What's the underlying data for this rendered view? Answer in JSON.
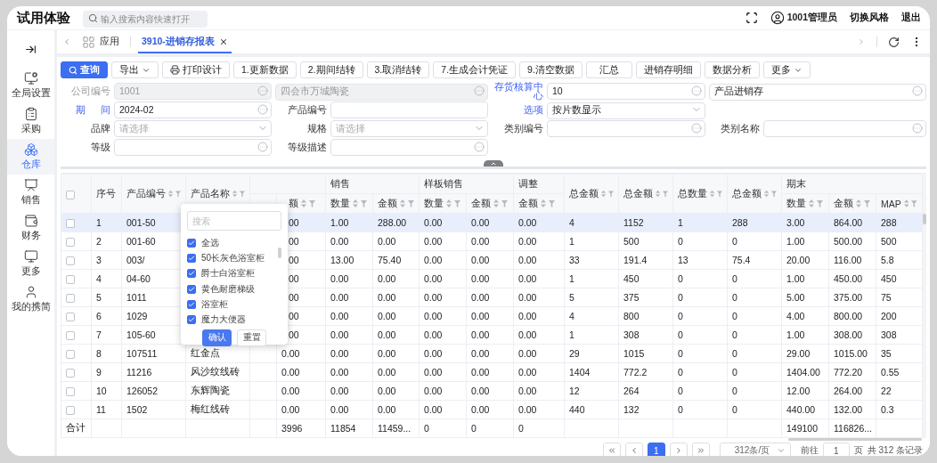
{
  "app": {
    "title": "试用体验",
    "search_placeholder": "输入搜索内容快速打开",
    "user": "1001管理员",
    "actions": [
      "切换风格",
      "退出"
    ]
  },
  "sidebar": {
    "items": [
      {
        "label": "全局设置",
        "selected": false
      },
      {
        "label": "采购",
        "selected": false
      },
      {
        "label": "仓库",
        "selected": true
      },
      {
        "label": "销售",
        "selected": false
      },
      {
        "label": "财务",
        "selected": false
      },
      {
        "label": "更多",
        "selected": false
      },
      {
        "label": "我的携简",
        "selected": false
      }
    ]
  },
  "tabs": [
    {
      "label": "应用",
      "kind": "home",
      "selected": false
    },
    {
      "label": "3910-进销存报表",
      "kind": "page",
      "selected": true
    }
  ],
  "toolbar": [
    {
      "label": "查询",
      "kind": "primary"
    },
    {
      "label": "导出",
      "kind": "dropdown"
    },
    {
      "label": "打印设计",
      "kind": "print"
    },
    {
      "label": "1.更新数据",
      "kind": "plain"
    },
    {
      "label": "2.期间结转",
      "kind": "plain"
    },
    {
      "label": "3.取消结转",
      "kind": "plain"
    },
    {
      "label": "7.生成会计凭证",
      "kind": "plain"
    },
    {
      "label": "9.清空数据",
      "kind": "plain"
    },
    {
      "label": "汇总",
      "kind": "plain"
    },
    {
      "label": "进销存明细",
      "kind": "plain"
    },
    {
      "label": "数据分析",
      "kind": "plain"
    },
    {
      "label": "更多",
      "kind": "dropdown"
    }
  ],
  "filters": [
    [
      {
        "label": "公司编号",
        "label_link": false,
        "field": {
          "kind": "lookup",
          "value": "1001",
          "disabled": true
        }
      },
      {
        "field": {
          "kind": "lookup",
          "value": "四会市万城陶瓷",
          "disabled": true
        }
      },
      {
        "label": "存货核算中心",
        "label_link": true,
        "field": {
          "kind": "lookup",
          "value": "10",
          "disabled": false
        }
      },
      {
        "field": {
          "kind": "lookup",
          "value": "产品进销存",
          "disabled": false
        }
      }
    ],
    [
      {
        "label": "期 间",
        "label_link": true,
        "field": {
          "kind": "lookup",
          "value": "2024-02",
          "disabled": false
        }
      },
      {
        "label": "产品编号",
        "label_link": false,
        "field": {
          "kind": "text",
          "disabled": false
        }
      },
      {
        "label": "选项",
        "label_link": true,
        "field": {
          "kind": "select",
          "value": "按片数显示",
          "disabled": false
        }
      }
    ],
    [
      {
        "label": "品牌",
        "label_link": false,
        "field": {
          "kind": "select",
          "placeholder": "请选择",
          "disabled": false
        }
      },
      {
        "label": "规格",
        "label_link": false,
        "field": {
          "kind": "select",
          "placeholder": "请选择",
          "disabled": false
        }
      },
      {
        "label": "类别编号",
        "label_link": false,
        "field": {
          "kind": "lookup",
          "disabled": false
        }
      },
      {
        "label": "类别名称",
        "label_link": false,
        "field": {
          "kind": "lookup",
          "disabled": false
        }
      }
    ],
    [
      {
        "label": "等级",
        "label_link": false,
        "field": {
          "kind": "lookup",
          "disabled": false
        }
      },
      {
        "label": "等级描述",
        "label_link": false,
        "field": {
          "kind": "lookup",
          "disabled": false
        }
      }
    ]
  ],
  "table": {
    "all_checked": false,
    "fixed_columns": [
      {
        "label": "序号"
      },
      {
        "label": "产品编号"
      },
      {
        "label": "产品名称"
      }
    ],
    "groups": [
      {
        "kind": "untitled",
        "columns": [
          {
            "label": "额"
          }
        ]
      },
      {
        "kind": "titled",
        "title": "销售",
        "columns": [
          {
            "label": "数量"
          },
          {
            "label": "金额"
          }
        ]
      },
      {
        "kind": "titled",
        "title": "样板销售",
        "columns": [
          {
            "label": "数量"
          },
          {
            "label": "金额"
          }
        ]
      },
      {
        "kind": "titled",
        "title": "调整",
        "columns": [
          {
            "label": "金额"
          }
        ]
      },
      {
        "kind": "single",
        "columns": [
          {
            "label": "总金额"
          }
        ]
      },
      {
        "kind": "single",
        "columns": [
          {
            "label": "总金额"
          }
        ]
      },
      {
        "kind": "single",
        "columns": [
          {
            "label": "总数量"
          }
        ]
      },
      {
        "kind": "single",
        "columns": [
          {
            "label": "总金额"
          }
        ]
      },
      {
        "kind": "titled",
        "title": "期末",
        "columns": [
          {
            "label": "数量"
          },
          {
            "label": "金额"
          },
          {
            "label": "MAP"
          }
        ]
      }
    ],
    "rows": [
      {
        "no": "1",
        "code": "001-50",
        "selected": true,
        "checked": false,
        "values": [
          "00",
          "1.00",
          "288.00",
          "0.00",
          "0.00",
          "0.00",
          "4",
          "1152",
          "1",
          "288",
          "3.00",
          "864.00",
          "288"
        ]
      },
      {
        "no": "2",
        "code": "001-60",
        "selected": false,
        "checked": false,
        "values": [
          "00",
          "0.00",
          "0.00",
          "0.00",
          "0.00",
          "0.00",
          "1",
          "500",
          "0",
          "0",
          "1.00",
          "500.00",
          "500"
        ]
      },
      {
        "no": "3",
        "code": "003/",
        "selected": false,
        "checked": false,
        "values": [
          "00",
          "13.00",
          "75.40",
          "0.00",
          "0.00",
          "0.00",
          "33",
          "191.4",
          "13",
          "75.4",
          "20.00",
          "116.00",
          "5.8"
        ]
      },
      {
        "no": "4",
        "code": "04-60",
        "selected": false,
        "checked": false,
        "values": [
          "00",
          "0.00",
          "0.00",
          "0.00",
          "0.00",
          "0.00",
          "1",
          "450",
          "0",
          "0",
          "1.00",
          "450.00",
          "450"
        ]
      },
      {
        "no": "5",
        "code": "1011",
        "selected": false,
        "checked": false,
        "values": [
          "00",
          "0.00",
          "0.00",
          "0.00",
          "0.00",
          "0.00",
          "5",
          "375",
          "0",
          "0",
          "5.00",
          "375.00",
          "75"
        ]
      },
      {
        "no": "6",
        "code": "1029",
        "selected": false,
        "checked": false,
        "values": [
          "00",
          "0.00",
          "0.00",
          "0.00",
          "0.00",
          "0.00",
          "4",
          "800",
          "0",
          "0",
          "4.00",
          "800.00",
          "200"
        ]
      },
      {
        "no": "7",
        "code": "105-60",
        "selected": false,
        "checked": false,
        "values": [
          "00",
          "0.00",
          "0.00",
          "0.00",
          "0.00",
          "0.00",
          "1",
          "308",
          "0",
          "0",
          "1.00",
          "308.00",
          "308"
        ]
      },
      {
        "no": "8",
        "code": "107511",
        "name": "红金点",
        "selected": false,
        "checked": false,
        "values": [
          "0.00",
          "0.00",
          "0.00",
          "0.00",
          "0.00",
          "0.00",
          "29",
          "1015",
          "0",
          "0",
          "29.00",
          "1015.00",
          "35"
        ]
      },
      {
        "no": "9",
        "code": "11216",
        "name": "风沙纹线砖",
        "selected": false,
        "checked": false,
        "values": [
          "0.00",
          "0.00",
          "0.00",
          "0.00",
          "0.00",
          "0.00",
          "1404",
          "772.2",
          "0",
          "0",
          "1404.00",
          "772.20",
          "0.55"
        ]
      },
      {
        "no": "10",
        "code": "126052",
        "name": "东辉陶瓷",
        "selected": false,
        "checked": false,
        "values": [
          "0.00",
          "0.00",
          "0.00",
          "0.00",
          "0.00",
          "0.00",
          "12",
          "264",
          "0",
          "0",
          "12.00",
          "264.00",
          "22"
        ]
      },
      {
        "no": "11",
        "code": "1502",
        "name": "梅红线砖",
        "selected": false,
        "checked": false,
        "values": [
          "0.00",
          "0.00",
          "0.00",
          "0.00",
          "0.00",
          "0.00",
          "440",
          "132",
          "0",
          "0",
          "440.00",
          "132.00",
          "0.3"
        ]
      }
    ],
    "total": {
      "label": "合计",
      "values": [
        "3996",
        "11854",
        "11459...",
        "0",
        "0",
        "0"
      ],
      "closing_values": [
        "149100",
        "116826..."
      ]
    }
  },
  "filter_popup": {
    "search_placeholder": "搜索",
    "options": [
      {
        "label": "全选",
        "checked": true
      },
      {
        "label": "50长灰色浴室柜",
        "checked": true
      },
      {
        "label": "爵士白浴室柜",
        "checked": true
      },
      {
        "label": "黄色耐磨梯级",
        "checked": true
      },
      {
        "label": "浴室柜",
        "checked": true
      },
      {
        "label": "魔力大便器",
        "checked": true
      }
    ],
    "buttons": [
      {
        "label": "确认",
        "kind": "primary"
      },
      {
        "label": "重置",
        "kind": "default"
      }
    ]
  },
  "pagination": {
    "pages": [
      {
        "label": "1",
        "selected": true
      }
    ],
    "page_size": "312条/页",
    "goto_label": "前往",
    "goto_value": "1",
    "page_unit": "页",
    "total": "共 312 条记录"
  }
}
